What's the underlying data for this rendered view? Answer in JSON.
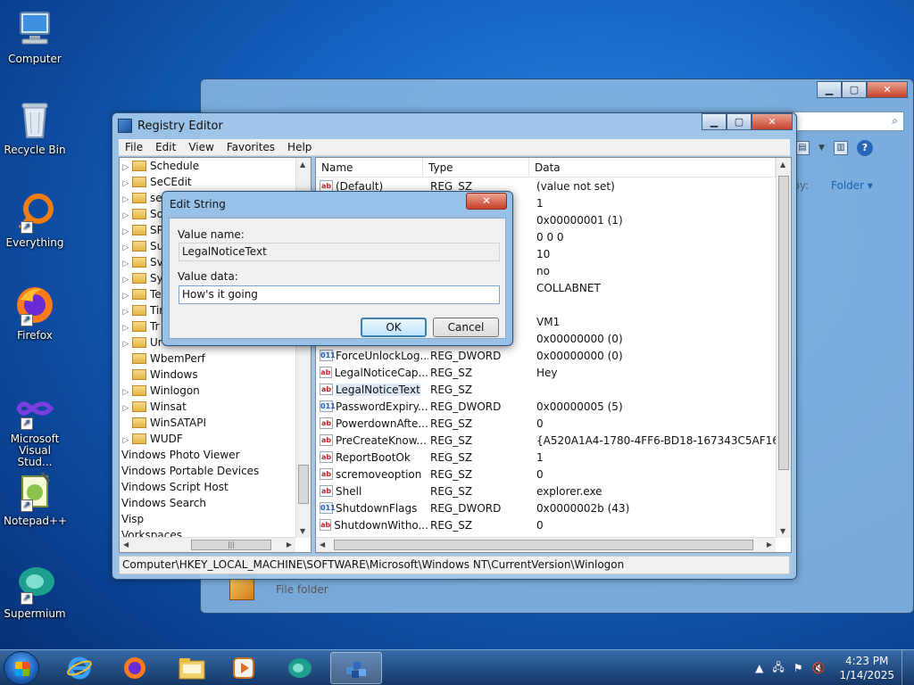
{
  "desktop": {
    "icons": [
      {
        "label": "Computer",
        "icon": "computer-icon"
      },
      {
        "label": "Recycle Bin",
        "icon": "recycle-bin-icon"
      },
      {
        "label": "Everything",
        "icon": "everything-icon"
      },
      {
        "label": "Firefox",
        "icon": "firefox-icon"
      },
      {
        "label": "Microsoft Visual Stud...",
        "icon": "visual-studio-icon"
      },
      {
        "label": "Notepad++",
        "icon": "notepad-plus-plus-icon"
      },
      {
        "label": "Supermium",
        "icon": "supermium-icon"
      }
    ]
  },
  "explorer": {
    "arrange_label": "e by:",
    "arrange_value": "Folder",
    "file_folder": "File folder"
  },
  "regedit": {
    "title": "Registry Editor",
    "menu": [
      "File",
      "Edit",
      "View",
      "Favorites",
      "Help"
    ],
    "tree": [
      {
        "label": "Schedule",
        "expand": "▷"
      },
      {
        "label": "SeCEdit",
        "expand": "▷"
      },
      {
        "label": "se",
        "expand": "▷"
      },
      {
        "label": "So",
        "expand": "▷"
      },
      {
        "label": "SP",
        "expand": "▷"
      },
      {
        "label": "Su",
        "expand": "▷"
      },
      {
        "label": "Sv",
        "expand": "▷"
      },
      {
        "label": "Sy",
        "expand": "▷"
      },
      {
        "label": "Te",
        "expand": "▷"
      },
      {
        "label": "Tir",
        "expand": "▷"
      },
      {
        "label": "Tr",
        "expand": "▷"
      },
      {
        "label": "Ur",
        "expand": "▷"
      },
      {
        "label": "WbemPerf",
        "expand": ""
      },
      {
        "label": "Windows",
        "expand": ""
      },
      {
        "label": "Winlogon",
        "expand": "▷"
      },
      {
        "label": "Winsat",
        "expand": "▷"
      },
      {
        "label": "WinSATAPI",
        "expand": ""
      },
      {
        "label": "WUDF",
        "expand": "▷"
      }
    ],
    "tree_roots": [
      "Vindows Photo Viewer",
      "Vindows Portable Devices",
      "Vindows Script Host",
      "Vindows Search",
      "Visp",
      "Vorkspaces"
    ],
    "columns": {
      "name": "Name",
      "type": "Type",
      "data": "Data"
    },
    "values": [
      {
        "name": "(Default)",
        "type": "REG_SZ",
        "data": "(value not set)",
        "kind": "sz"
      },
      {
        "name": "",
        "type": "",
        "data": "1",
        "kind": ""
      },
      {
        "name": "",
        "type": "",
        "data": "0x00000001 (1)",
        "kind": ""
      },
      {
        "name": "",
        "type": "",
        "data": "0 0 0",
        "kind": ""
      },
      {
        "name": "",
        "type": "",
        "data": "10",
        "kind": ""
      },
      {
        "name": "",
        "type": "",
        "data": "no",
        "kind": ""
      },
      {
        "name": "",
        "type": "",
        "data": "COLLABNET",
        "kind": ""
      },
      {
        "name": "",
        "type": "",
        "data": "",
        "kind": ""
      },
      {
        "name": "",
        "type": "",
        "data": "VM1",
        "kind": ""
      },
      {
        "name": "",
        "type": "",
        "data": "0x00000000 (0)",
        "kind": ""
      },
      {
        "name": "ForceUnlockLog...",
        "type": "REG_DWORD",
        "data": "0x00000000 (0)",
        "kind": "dw"
      },
      {
        "name": "LegalNoticeCap...",
        "type": "REG_SZ",
        "data": "Hey",
        "kind": "sz"
      },
      {
        "name": "LegalNoticeText",
        "type": "REG_SZ",
        "data": "",
        "kind": "sz"
      },
      {
        "name": "PasswordExpiry...",
        "type": "REG_DWORD",
        "data": "0x00000005 (5)",
        "kind": "dw"
      },
      {
        "name": "PowerdownAfte...",
        "type": "REG_SZ",
        "data": "0",
        "kind": "sz"
      },
      {
        "name": "PreCreateKnow...",
        "type": "REG_SZ",
        "data": "{A520A1A4-1780-4FF6-BD18-167343C5AF16}",
        "kind": "sz"
      },
      {
        "name": "ReportBootOk",
        "type": "REG_SZ",
        "data": "1",
        "kind": "sz"
      },
      {
        "name": "scremoveoption",
        "type": "REG_SZ",
        "data": "0",
        "kind": "sz"
      },
      {
        "name": "Shell",
        "type": "REG_SZ",
        "data": "explorer.exe",
        "kind": "sz"
      },
      {
        "name": "ShutdownFlags",
        "type": "REG_DWORD",
        "data": "0x0000002b (43)",
        "kind": "dw"
      },
      {
        "name": "ShutdownWitho...",
        "type": "REG_SZ",
        "data": "0",
        "kind": "sz"
      }
    ],
    "status": "Computer\\HKEY_LOCAL_MACHINE\\SOFTWARE\\Microsoft\\Windows NT\\CurrentVersion\\Winlogon"
  },
  "dialog": {
    "title": "Edit String",
    "value_name_label": "Value name:",
    "value_name": "LegalNoticeText",
    "value_data_label": "Value data:",
    "value_data": "How's it going",
    "ok": "OK",
    "cancel": "Cancel"
  },
  "taskbar": {
    "time": "4:23 PM",
    "date": "1/14/2025",
    "apps": [
      "internet-explorer-icon",
      "firefox-icon",
      "file-explorer-icon",
      "media-player-icon",
      "supermium-icon",
      "registry-editor-icon"
    ]
  },
  "colors": {
    "accent": "#1f5fb6",
    "close": "#c6402a"
  }
}
